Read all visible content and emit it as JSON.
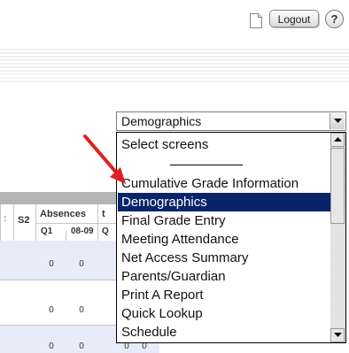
{
  "header": {
    "logout_label": "Logout",
    "help_label": "?"
  },
  "table": {
    "col_s2": "S2",
    "absences_label": "Absences",
    "cut_letter": "t",
    "sub_q1": "Q1",
    "sub_0809": "08-09",
    "sub_cut": "Q",
    "rows": [
      {
        "q1": "0",
        "y0809": "0"
      },
      {
        "q1": "0",
        "y0809": "0"
      },
      {
        "q1": "0",
        "y0809": "0",
        "extra1": "0",
        "extra2": "0"
      }
    ]
  },
  "screen_select": {
    "value": "Demographics",
    "options": [
      "Select screens",
      "",
      "Cumulative Grade Information",
      "Demographics",
      "Final Grade Entry",
      "Meeting Attendance",
      "Net Access Summary",
      "Parents/Guardian",
      "Print A Report",
      "Quick Lookup",
      "Schedule"
    ],
    "selected_index": 3
  },
  "colors": {
    "selection": "#0a246a",
    "arrow": "#e02020",
    "row_bg": "#e8ecf8"
  }
}
